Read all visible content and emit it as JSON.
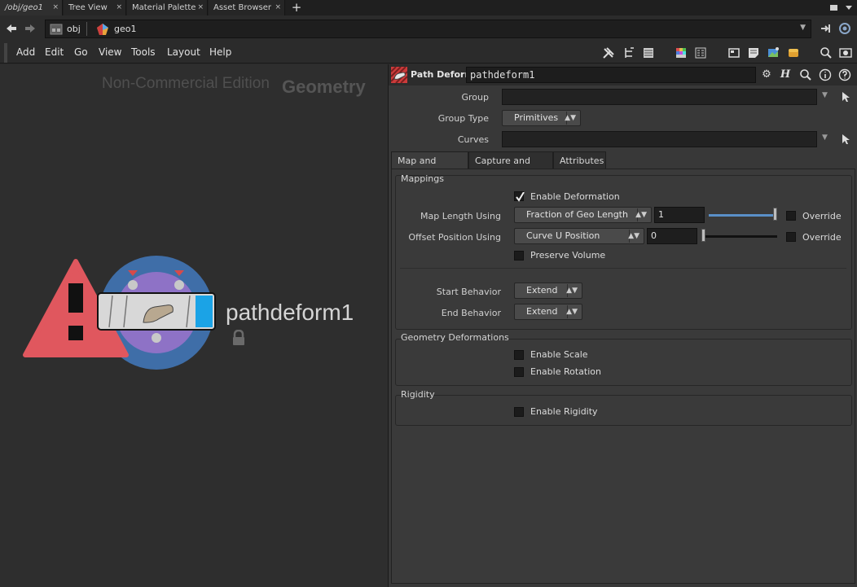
{
  "tabs": [
    {
      "label": "/obj/geo1",
      "active": true
    },
    {
      "label": "Tree View",
      "active": false
    },
    {
      "label": "Material Palette",
      "active": false
    },
    {
      "label": "Asset Browser",
      "active": false
    }
  ],
  "tab_close": "×",
  "tab_add": "+",
  "path": {
    "crumbs": [
      "obj",
      "geo1"
    ]
  },
  "menu": [
    "Add",
    "Edit",
    "Go",
    "View",
    "Tools",
    "Layout",
    "Help"
  ],
  "network": {
    "edition": "Non-Commercial Edition",
    "context": "Geometry",
    "node_name": "pathdeform1"
  },
  "params": {
    "node_type": "Path Deform",
    "node_name": "pathdeform1",
    "group_label": "Group",
    "group_value": "",
    "group_type_label": "Group Type",
    "group_type_value": "Primitives",
    "curves_label": "Curves",
    "curves_value": "",
    "tabs": [
      "Map and Deform",
      "Capture and Align",
      "Attributes"
    ],
    "mappings": {
      "title": "Mappings",
      "enable_deformation": "Enable Deformation",
      "enable_deformation_checked": true,
      "map_length_label": "Map Length Using",
      "map_length_value": "Fraction of Geo Length",
      "map_length_number": "1",
      "map_length_slider": 1.0,
      "override_label": "Override",
      "offset_label": "Offset Position Using",
      "offset_value": "Curve U Position",
      "offset_number": "0",
      "offset_slider": 0.0,
      "override2_label": "Override",
      "preserve_volume": "Preserve Volume",
      "start_label": "Start Behavior",
      "start_value": "Extend",
      "end_label": "End Behavior",
      "end_value": "Extend"
    },
    "geo_deform": {
      "title": "Geometry Deformations",
      "enable_scale": "Enable Scale",
      "enable_rotation": "Enable Rotation"
    },
    "rigidity": {
      "title": "Rigidity",
      "enable_rigidity": "Enable Rigidity"
    }
  },
  "colors": {
    "accent": "#5a8fc8",
    "warning": "#e0575e",
    "node_ring": "#3f6ea8",
    "node_fill": "#8e72c6",
    "node_flag": "#1ba3e6"
  }
}
